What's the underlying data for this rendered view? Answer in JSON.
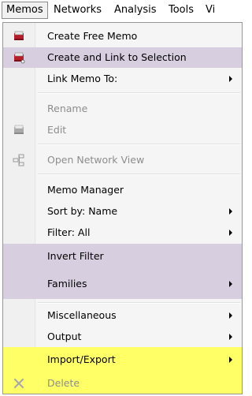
{
  "menubar": {
    "items": [
      {
        "label": "Memos"
      },
      {
        "label": "Networks"
      },
      {
        "label": "Analysis"
      },
      {
        "label": "Tools"
      },
      {
        "label": "Vi"
      }
    ]
  },
  "menu": {
    "items": [
      {
        "label": "Create Free Memo",
        "icon": "memo-icon"
      },
      {
        "label": "Create and Link to Selection",
        "icon": "memo-link-icon"
      },
      {
        "label": "Link Memo To:"
      },
      {
        "label": "Rename"
      },
      {
        "label": "Edit",
        "icon": "edit-memo-icon"
      },
      {
        "label": "Open Network View",
        "icon": "network-icon"
      },
      {
        "label": "Memo Manager"
      },
      {
        "label": "Sort by: Name"
      },
      {
        "label": "Filter: All"
      },
      {
        "label": "Invert Filter"
      },
      {
        "label": "Families"
      },
      {
        "label": "Miscellaneous"
      },
      {
        "label": "Output"
      },
      {
        "label": "Import/Export"
      },
      {
        "label": "Delete",
        "icon": "delete-icon"
      }
    ]
  },
  "colors": {
    "highlight_purple": "#d7cee0",
    "highlight_yellow": "#ffff66"
  }
}
